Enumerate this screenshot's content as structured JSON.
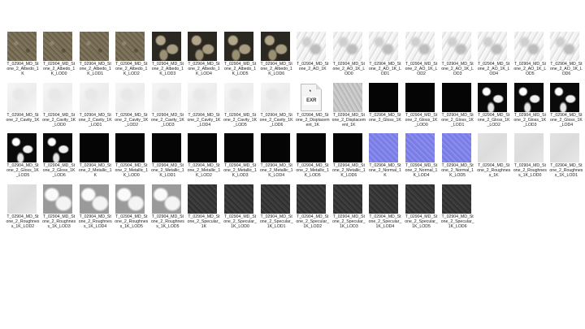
{
  "files": [
    {
      "name": "T_02904_MD_Stone_2_Albedo_1K",
      "kind": "albedo"
    },
    {
      "name": "T_02904_MD_Stone_2_Albedo_1K_LOD0",
      "kind": "albedo"
    },
    {
      "name": "T_02904_MD_Stone_2_Albedo_1K_LOD1",
      "kind": "albedo"
    },
    {
      "name": "T_02904_MD_Stone_2_Albedo_1K_LOD2",
      "kind": "albedo"
    },
    {
      "name": "T_02904_MD_Stone_2_Albedo_1K_LOD3",
      "kind": "albedo-dark"
    },
    {
      "name": "T_02904_MD_Stone_2_Albedo_1K_LOD4",
      "kind": "albedo-dark"
    },
    {
      "name": "T_02904_MD_Stone_2_Albedo_1K_LOD5",
      "kind": "albedo-dark"
    },
    {
      "name": "T_02904_MD_Stone_2_Albedo_1K_LOD6",
      "kind": "albedo-dark"
    },
    {
      "name": "T_02904_MD_Stone_2_AO_1K",
      "kind": "ao"
    },
    {
      "name": "T_02904_MD_Stone_2_AO_1K_LOD0",
      "kind": "ao"
    },
    {
      "name": "T_02904_MD_Stone_2_AO_1K_LOD1",
      "kind": "ao"
    },
    {
      "name": "T_02904_MD_Stone_2_AO_1K_LOD2",
      "kind": "ao"
    },
    {
      "name": "T_02904_MD_Stone_2_AO_1K_LOD3",
      "kind": "ao"
    },
    {
      "name": "T_02904_MD_Stone_2_AO_1K_LOD4",
      "kind": "ao"
    },
    {
      "name": "T_02904_MD_Stone_2_AO_1K_LOD5",
      "kind": "ao"
    },
    {
      "name": "T_02904_MD_Stone_2_AO_1K_LOD6",
      "kind": "ao"
    },
    {
      "name": "T_02904_MD_Stone_2_Cavity_1K",
      "kind": "cavity"
    },
    {
      "name": "T_02904_MD_Stone_2_Cavity_1K_LOD0",
      "kind": "cavity"
    },
    {
      "name": "T_02904_MD_Stone_2_Cavity_1K_LOD1",
      "kind": "cavity"
    },
    {
      "name": "T_02904_MD_Stone_2_Cavity_1K_LOD2",
      "kind": "cavity"
    },
    {
      "name": "T_02904_MD_Stone_2_Cavity_1K_LOD3",
      "kind": "cavity"
    },
    {
      "name": "T_02904_MD_Stone_2_Cavity_1K_LOD4",
      "kind": "cavity"
    },
    {
      "name": "T_02904_MD_Stone_2_Cavity_1K_LOD5",
      "kind": "cavity"
    },
    {
      "name": "T_02904_MD_Stone_2_Cavity_1K_LOD6",
      "kind": "cavity"
    },
    {
      "name": "T_02904_MD_Stone_2_Displacement_1K",
      "kind": "exr",
      "badge": "EXR"
    },
    {
      "name": "T_02904_MD_Stone_2_Displacement_1K",
      "kind": "disp"
    },
    {
      "name": "T_02904_MD_Stone_2_Gloss_1K",
      "kind": "black"
    },
    {
      "name": "T_02904_MD_Stone_2_Gloss_1K_LOD0",
      "kind": "black"
    },
    {
      "name": "T_02904_MD_Stone_2_Gloss_1K_LOD1",
      "kind": "black"
    },
    {
      "name": "T_02904_MD_Stone_2_Gloss_1K_LOD2",
      "kind": "blackblob"
    },
    {
      "name": "T_02904_MD_Stone_2_Gloss_1K_LOD3",
      "kind": "blackblob"
    },
    {
      "name": "T_02904_MD_Stone_2_Gloss_1K_LOD4",
      "kind": "blackblob"
    },
    {
      "name": "T_02904_MD_Stone_2_Gloss_1K_LOD5",
      "kind": "blackblob"
    },
    {
      "name": "T_02904_MD_Stone_2_Gloss_1K_LOD6",
      "kind": "blackblob"
    },
    {
      "name": "T_02904_MD_Stone_2_Metallic_1K",
      "kind": "black"
    },
    {
      "name": "T_02904_MD_Stone_2_Metallic_1K_LOD0",
      "kind": "black"
    },
    {
      "name": "T_02904_MD_Stone_2_Metallic_1K_LOD1",
      "kind": "black"
    },
    {
      "name": "T_02904_MD_Stone_2_Metallic_1K_LOD2",
      "kind": "black"
    },
    {
      "name": "T_02904_MD_Stone_2_Metallic_1K_LOD3",
      "kind": "black"
    },
    {
      "name": "T_02904_MD_Stone_2_Metallic_1K_LOD4",
      "kind": "black"
    },
    {
      "name": "T_02904_MD_Stone_2_Metallic_1K_LOD5",
      "kind": "black"
    },
    {
      "name": "T_02904_MD_Stone_2_Metallic_1K_LOD6",
      "kind": "black"
    },
    {
      "name": "T_02904_MD_Stone_2_Normal_1K",
      "kind": "normal"
    },
    {
      "name": "T_02904_MD_Stone_2_Normal_1K_LOD4",
      "kind": "normal"
    },
    {
      "name": "T_02904_MD_Stone_2_Normal_1K_LOD5",
      "kind": "normal"
    },
    {
      "name": "T_02904_MD_Stone_2_Roughness_1K",
      "kind": "rough"
    },
    {
      "name": "T_02904_MD_Stone_2_Roughness_1K_LOD0",
      "kind": "rough"
    },
    {
      "name": "T_02904_MD_Stone_2_Roughness_1K_LOD1",
      "kind": "rough"
    },
    {
      "name": "T_02904_MD_Stone_2_Roughness_1K_LOD2",
      "kind": "rough"
    },
    {
      "name": "T_02904_MD_Stone_2_Roughness_1K_LOD3",
      "kind": "roughblob"
    },
    {
      "name": "T_02904_MD_Stone_2_Roughness_1K_LOD4",
      "kind": "roughblob"
    },
    {
      "name": "T_02904_MD_Stone_2_Roughness_1K_LOD5",
      "kind": "roughblob"
    },
    {
      "name": "T_02904_MD_Stone_2_Roughness_1K_LOD5",
      "kind": "roughblob"
    },
    {
      "name": "T_02904_MD_Stone_2_Specular_1K",
      "kind": "spec"
    },
    {
      "name": "T_02904_MD_Stone_2_Specular_1K_LOD0",
      "kind": "spec"
    },
    {
      "name": "T_02904_MD_Stone_2_Specular_1K_LOD1",
      "kind": "spec"
    },
    {
      "name": "T_02904_MD_Stone_2_Specular_1K_LOD2",
      "kind": "spec"
    },
    {
      "name": "T_02904_MD_Stone_2_Specular_1K_LOD3",
      "kind": "spec"
    },
    {
      "name": "T_02904_MD_Stone_2_Specular_1K_LOD4",
      "kind": "spec"
    },
    {
      "name": "T_02904_MD_Stone_2_Specular_1K_LOD5",
      "kind": "spec"
    },
    {
      "name": "T_02904_MD_Stone_2_Specular_1K_LOD6",
      "kind": "spec"
    }
  ]
}
